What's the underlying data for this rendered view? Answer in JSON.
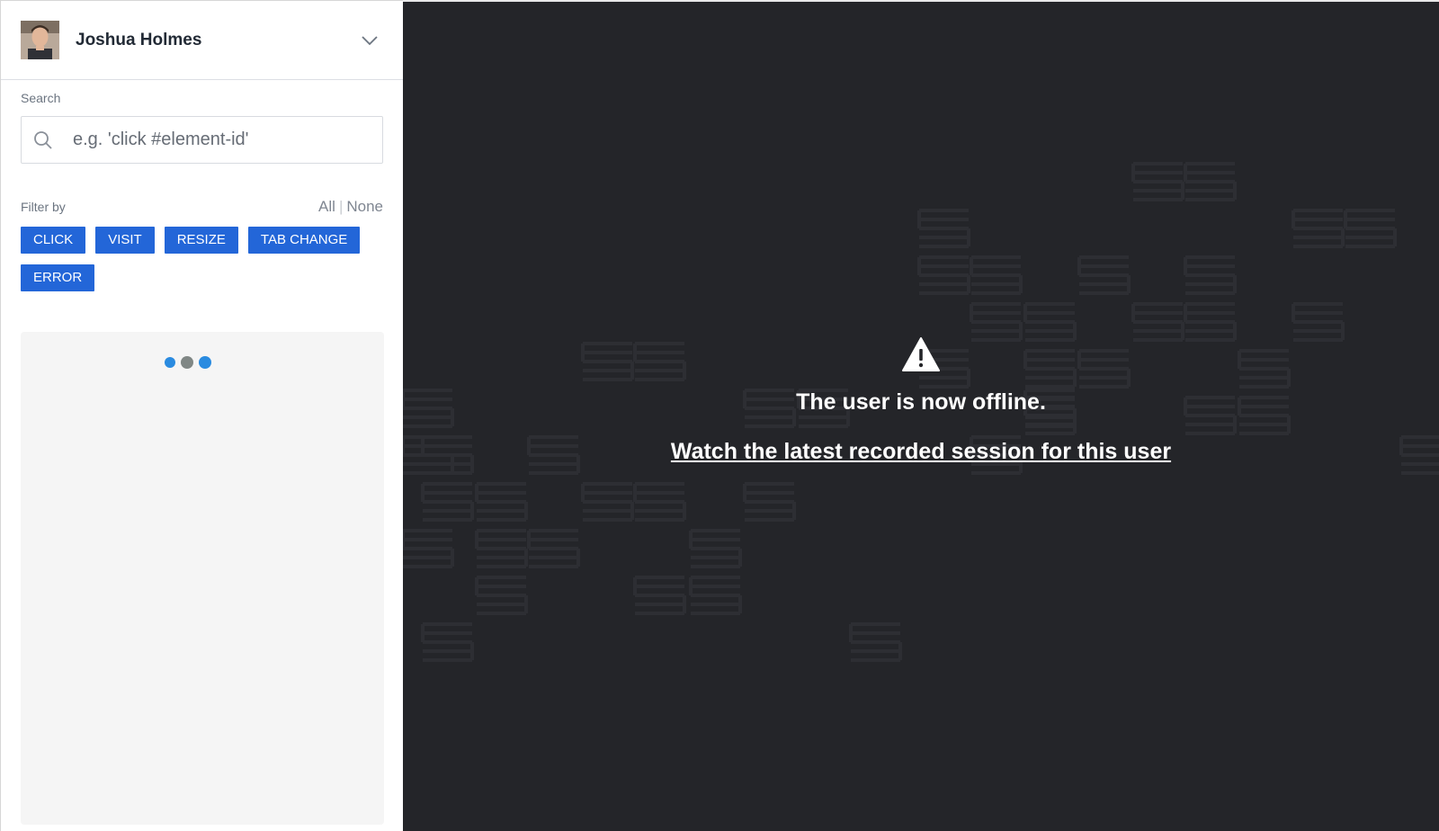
{
  "user": {
    "name": "Joshua Holmes"
  },
  "search": {
    "label": "Search",
    "placeholder": "e.g. 'click #element-id'",
    "value": ""
  },
  "filter": {
    "label": "Filter by",
    "all_label": "All",
    "none_label": "None",
    "chips": [
      "CLICK",
      "VISIT",
      "RESIZE",
      "TAB CHANGE",
      "ERROR"
    ]
  },
  "main": {
    "offline_message": "The user is now offline.",
    "session_link": "Watch the latest recorded session for this user"
  },
  "colors": {
    "accent": "#2366d8",
    "main_bg": "#242529",
    "loader_blue": "#2a8be0",
    "loader_gray": "#808785"
  },
  "icons": {
    "header_chevron": "chevron-down-icon",
    "search": "search-icon",
    "warning": "warning-icon"
  }
}
